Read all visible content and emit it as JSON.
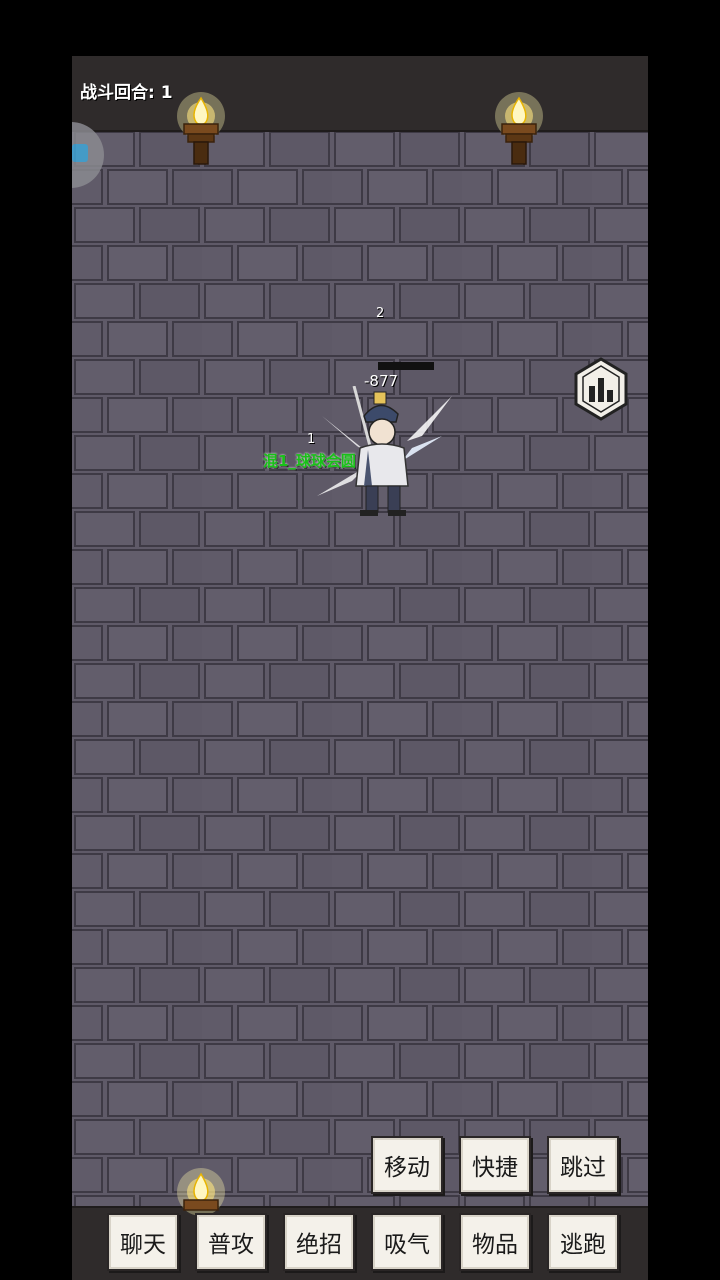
{
  "battle": {
    "round_label": "战斗回合: 1"
  },
  "character": {
    "name": "混1_球球会圆",
    "position_number": "1",
    "enemy_position_number": "2",
    "damage_text": "-877"
  },
  "action_buttons": {
    "top_row": [
      "移动",
      "快捷",
      "跳过"
    ],
    "bottom_row": [
      "聊天",
      "普攻",
      "绝招",
      "吸气",
      "物品",
      "逃跑"
    ]
  },
  "icons": {
    "torch": "wall-torch-icon",
    "stats": "stats-chart-icon",
    "side_float": "floating-app-icon"
  },
  "colors": {
    "wall": "#5f5a68",
    "name_text": "#19c019",
    "button_bg": "#f4f1ea"
  }
}
